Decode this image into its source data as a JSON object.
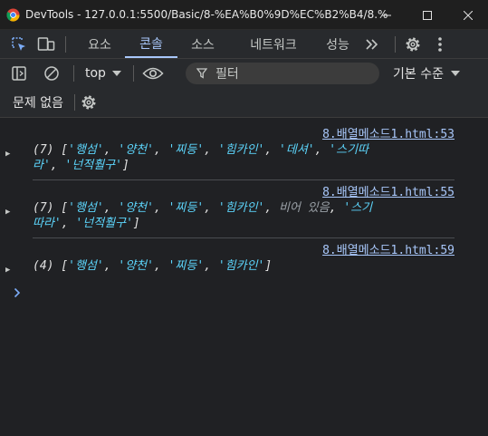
{
  "window": {
    "app_name": "DevTools",
    "title": "DevTools - 127.0.0.1:5500/Basic/8-%EA%B0%9D%EC%B2%B4/8.%E..."
  },
  "tabs": [
    {
      "label": "요소"
    },
    {
      "label": "콘솔"
    },
    {
      "label": "소스"
    },
    {
      "label": "네트워크"
    },
    {
      "label": "성능"
    }
  ],
  "toolbar": {
    "context": "top",
    "filter_placeholder": "필터",
    "level": "기본 수준"
  },
  "issues": {
    "label": "문제 없음"
  },
  "console": {
    "messages": [
      {
        "source": "8.배열메소드1.html:53",
        "line1_parts": [
          "(7) [",
          "'행섬'",
          ", ",
          "'양천'",
          ", ",
          "'찌등'",
          ", ",
          "'힘카인'",
          ", ",
          "'데셔'",
          ", ",
          "'스기따"
        ],
        "line2_parts": [
          "라'",
          ", ",
          "'넌적훨구'",
          "]"
        ]
      },
      {
        "source": "8.배열메소드1.html:55",
        "line1_parts": [
          "(7) [",
          "'행섬'",
          ", ",
          "'양천'",
          ", ",
          "'찌등'",
          ", ",
          "'힘카인'",
          ", ",
          "비어 있음",
          ", ",
          "'스기"
        ],
        "line2_parts": [
          "따라'",
          ", ",
          "'넌적훨구'",
          "]"
        ]
      },
      {
        "source": "8.배열메소드1.html:59",
        "line1_parts": [
          "(4) [",
          "'행섬'",
          ", ",
          "'양천'",
          ", ",
          "'찌등'",
          ", ",
          "'힘카인'",
          "]"
        ]
      }
    ]
  }
}
